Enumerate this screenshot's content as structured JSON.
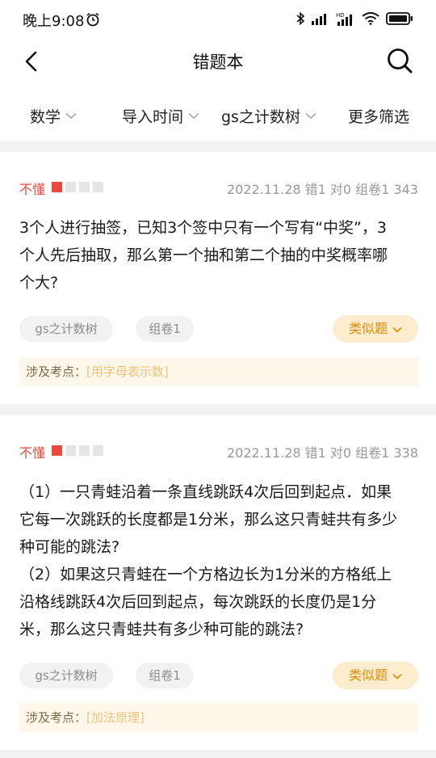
{
  "status_bar": {
    "time": "晚上9:08",
    "network": "HD"
  },
  "header": {
    "title": "错题本"
  },
  "filters": [
    {
      "label": "数学"
    },
    {
      "label": "导入时间"
    },
    {
      "label": "gs之计数树"
    },
    {
      "label": "更多筛选"
    }
  ],
  "cards": [
    {
      "level_label": "不懂",
      "level_filled": 1,
      "level_total": 4,
      "meta": "2022.11.28 错1 对0 组卷1 343",
      "question": [
        "3个人进行抽签，已知3个签中只有一个写有“中奖”，3",
        "个人先后抽取，那么第一个抽和第二个抽的中奖概率哪",
        "个大?"
      ],
      "tags": [
        "gs之计数树",
        "组卷1"
      ],
      "similar_label": "类似题",
      "points_label": "涉及考点：",
      "knowledge_point": "[用字母表示数]"
    },
    {
      "level_label": "不懂",
      "level_filled": 1,
      "level_total": 4,
      "meta": "2022.11.28 错1 对0 组卷1 338",
      "question": [
        "（1）一只青蛙沿着一条直线跳跃4次后回到起点．如果",
        "它每一次跳跃的长度都是1分米，那么这只青蛙共有多少",
        "种可能的跳法?",
        "（2）如果这只青蛙在一个方格边长为1分米的方格纸上",
        "沿格线跳跃4次后回到起点，每次跳跃的长度仍是1分",
        "米，那么这只青蛙共有多少种可能的跳法?"
      ],
      "tags": [
        "gs之计数树",
        "组卷1"
      ],
      "similar_label": "类似题",
      "points_label": "涉及考点：",
      "knowledge_point": "[加法原理]"
    }
  ],
  "colors": {
    "accent": "#e38a00",
    "level_red": "#e84a3c",
    "similar_bg": "#fdeccd",
    "points_bg": "#fff8ea",
    "divider": "#f2f2f2"
  }
}
